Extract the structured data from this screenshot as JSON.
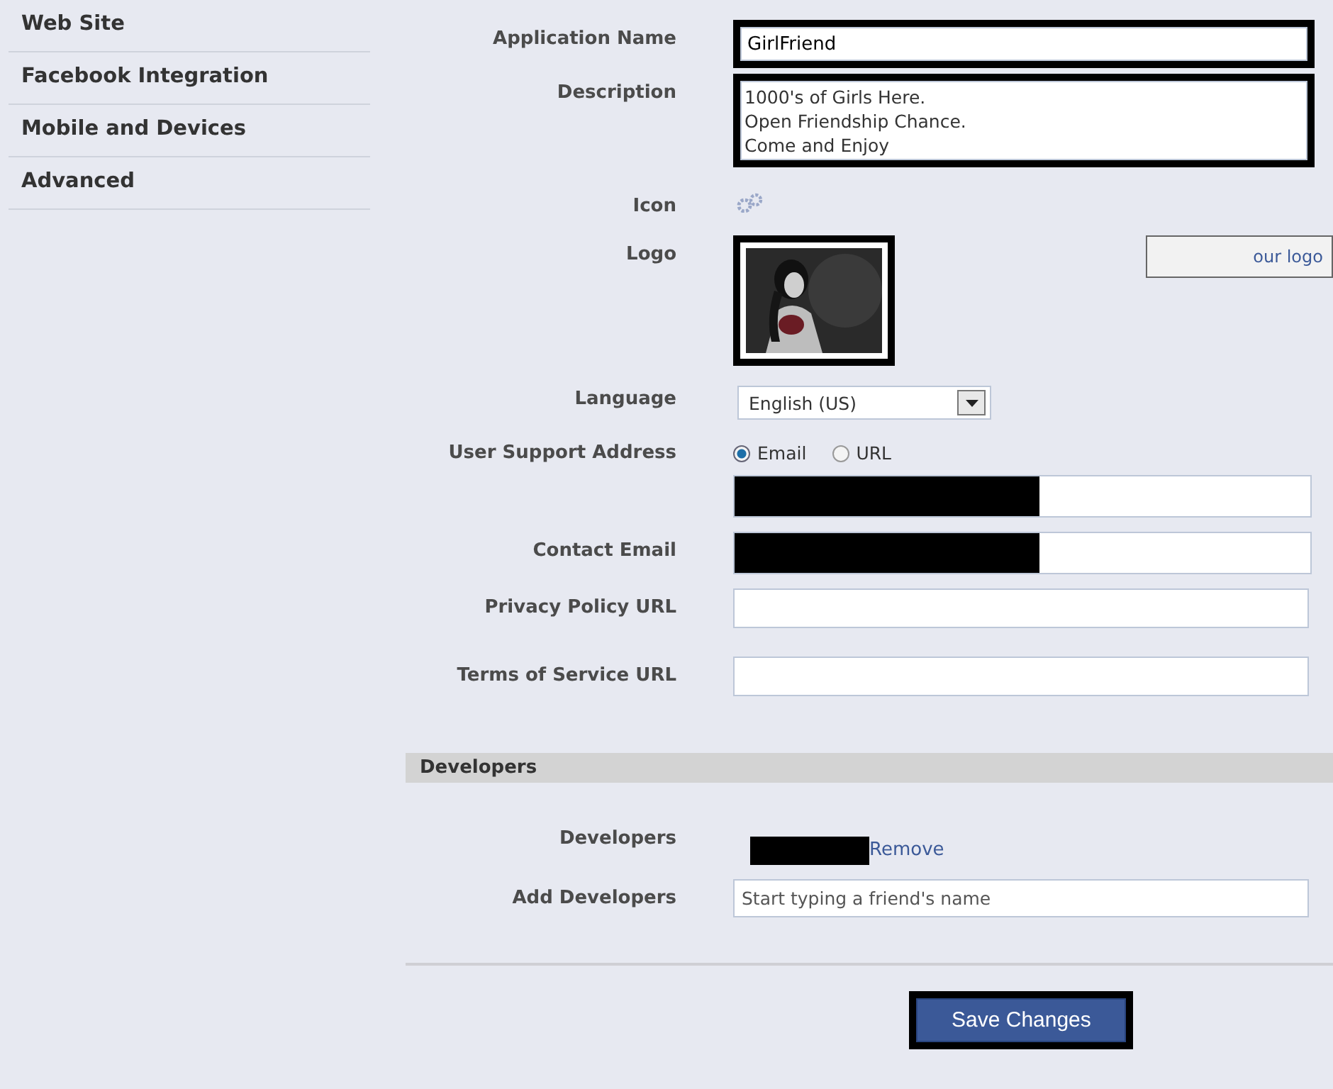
{
  "sidebar": {
    "items": [
      {
        "label": "Web Site",
        "selected": false
      },
      {
        "label": "Facebook Integration",
        "selected": false
      },
      {
        "label": "Mobile and Devices",
        "selected": false
      },
      {
        "label": "Advanced",
        "selected": false
      }
    ]
  },
  "form": {
    "fields": [
      {
        "kind": "text",
        "label": "Application Name",
        "value": "GirlFriend",
        "highlighted": true
      },
      {
        "kind": "textarea",
        "label": "Description",
        "lines": [
          "1000's of Girls Here.",
          "Open Friendship Chance.",
          "Come and Enjoy"
        ],
        "highlighted": true
      },
      {
        "kind": "icon",
        "label": "Icon"
      },
      {
        "kind": "logo",
        "label": "Logo",
        "button": "our logo",
        "highlighted": true
      },
      {
        "kind": "select",
        "label": "Language",
        "value": "English (US)"
      },
      {
        "kind": "radio",
        "label": "User Support Address",
        "options": [
          {
            "label": "Email",
            "selected": true
          },
          {
            "label": "URL",
            "selected": false
          }
        ]
      },
      {
        "kind": "redacted"
      },
      {
        "kind": "redacted",
        "label": "Contact Email"
      },
      {
        "kind": "text",
        "label": "Privacy Policy URL"
      },
      {
        "kind": "text",
        "label": "Terms of Service URL"
      }
    ]
  },
  "developers": {
    "title": "Developers",
    "label": "Developers",
    "remove": "Remove",
    "add_label": "Add Developers",
    "add_placeholder": "Start typing a friend's name"
  },
  "save_button": {
    "label": "Save Changes",
    "highlighted": true
  }
}
